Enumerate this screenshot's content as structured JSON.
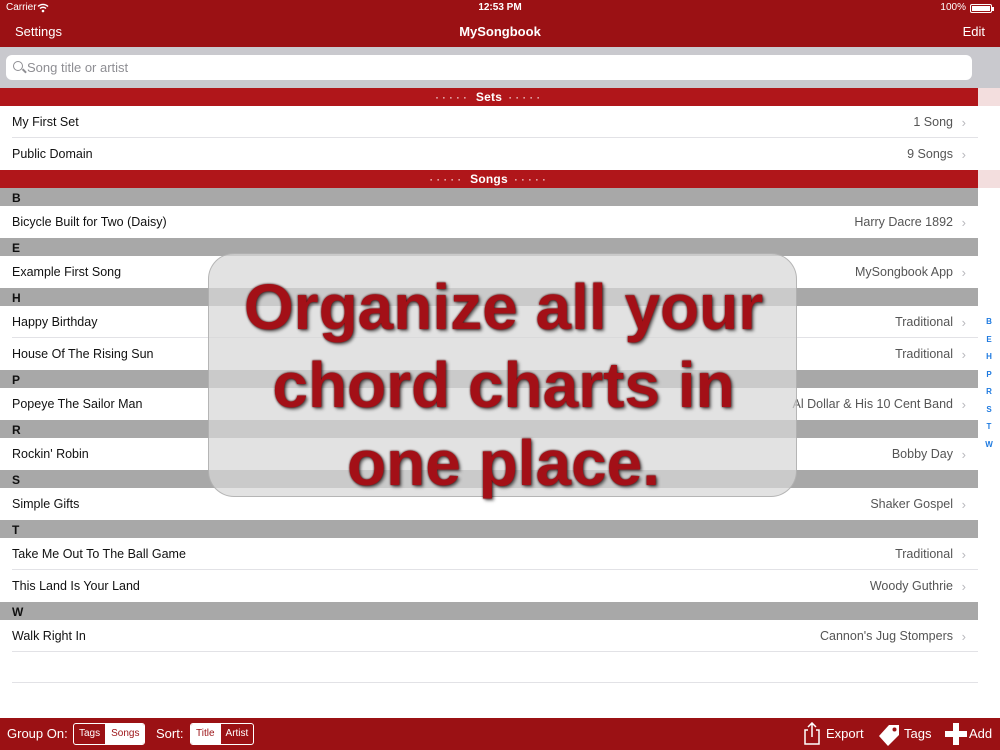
{
  "status_bar": {
    "carrier": "Carrier",
    "time": "12:53 PM",
    "battery": "100%",
    "battery_level": 1.0
  },
  "nav": {
    "left": "Settings",
    "title": "MySongbook",
    "right": "Edit"
  },
  "search": {
    "placeholder": "Song title or artist",
    "value": ""
  },
  "sets_header": "Sets",
  "sets": [
    {
      "title": "My First Set",
      "detail": "1 Song"
    },
    {
      "title": "Public Domain",
      "detail": "9 Songs"
    }
  ],
  "songs_header": "Songs",
  "song_groups": [
    {
      "letter": "B",
      "songs": [
        {
          "title": "Bicycle Built for Two (Daisy)",
          "artist": "Harry Dacre 1892"
        }
      ]
    },
    {
      "letter": "E",
      "songs": [
        {
          "title": "Example First Song",
          "artist": "MySongbook App"
        }
      ]
    },
    {
      "letter": "H",
      "songs": [
        {
          "title": "Happy Birthday",
          "artist": "Traditional"
        },
        {
          "title": "House Of The Rising Sun",
          "artist": "Traditional"
        }
      ]
    },
    {
      "letter": "P",
      "songs": [
        {
          "title": "Popeye The Sailor Man",
          "artist": "Al Dollar & His 10 Cent Band"
        }
      ]
    },
    {
      "letter": "R",
      "songs": [
        {
          "title": "Rockin' Robin",
          "artist": "Bobby Day"
        }
      ]
    },
    {
      "letter": "S",
      "songs": [
        {
          "title": "Simple Gifts",
          "artist": "Shaker Gospel"
        }
      ]
    },
    {
      "letter": "T",
      "songs": [
        {
          "title": "Take Me Out To The Ball Game",
          "artist": "Traditional"
        },
        {
          "title": "This Land Is Your Land",
          "artist": "Woody Guthrie"
        }
      ]
    },
    {
      "letter": "W",
      "songs": [
        {
          "title": "Walk Right In",
          "artist": "Cannon's Jug Stompers"
        }
      ]
    }
  ],
  "index_letters": [
    "B",
    "E",
    "H",
    "P",
    "R",
    "S",
    "T",
    "W"
  ],
  "toolbar": {
    "group_label": "Group On:",
    "group_options": [
      "Tags",
      "Songs"
    ],
    "group_selected": "Songs",
    "sort_label": "Sort:",
    "sort_options": [
      "Title",
      "Artist"
    ],
    "sort_selected": "Title",
    "export": "Export",
    "tags": "Tags",
    "add": "Add"
  },
  "overlay": {
    "lines": [
      "Organize all your",
      "chord charts in",
      "one place."
    ]
  },
  "colors": {
    "brand_red": "#9b1114",
    "header_red": "#b0161a",
    "letter_gray": "#a8a8a8",
    "index_blue": "#1e7ae0",
    "overlay_text": "#a31017"
  },
  "icons": {
    "search": "magnifier-icon",
    "chevron": "chevron-right-icon",
    "export": "share-icon",
    "tags": "tag-icon",
    "add": "plus-icon",
    "wifi": "wifi-icon",
    "battery": "battery-icon"
  }
}
